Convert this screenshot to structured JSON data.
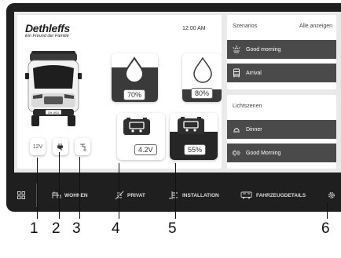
{
  "brand": {
    "name": "Dethleffs",
    "tagline": "Ein Freund der Familie"
  },
  "clock": "12:00 AM",
  "tanks": {
    "fresh_water_percent": "70%",
    "grey_water_percent": "80%"
  },
  "batteries": {
    "starter_voltage": "4.2V",
    "living_percent": "55%"
  },
  "small_tiles": {
    "voltage_label": "12V"
  },
  "camper_plate": "DH 1933",
  "scenarios": {
    "title": "Szenarios",
    "show_all": "Alle anzeigen",
    "items": [
      {
        "label": "Good morning",
        "icon": "sunrise-icon"
      },
      {
        "label": "Arrival",
        "icon": "arrival-icon"
      }
    ]
  },
  "light_scenes": {
    "title": "Lichtszenen",
    "items": [
      {
        "label": "Dinner",
        "icon": "dinner-icon"
      },
      {
        "label": "Good Morning",
        "icon": "sun-icon"
      }
    ]
  },
  "nav": {
    "items": [
      {
        "label": "WOHNEN",
        "icon": "living-icon"
      },
      {
        "label": "PRIVAT",
        "icon": "privacy-icon"
      },
      {
        "label": "INSTALLATION",
        "icon": "installation-icon"
      },
      {
        "label": "FAHRZEUGDETAILS",
        "icon": "vehicle-icon"
      }
    ]
  },
  "callouts": [
    "1",
    "2",
    "3",
    "4",
    "5",
    "6"
  ],
  "colors": {
    "tablet": "#1f1f1f",
    "panel_item": "#4a4a4a",
    "screen_bg": "#e9e9e9"
  }
}
